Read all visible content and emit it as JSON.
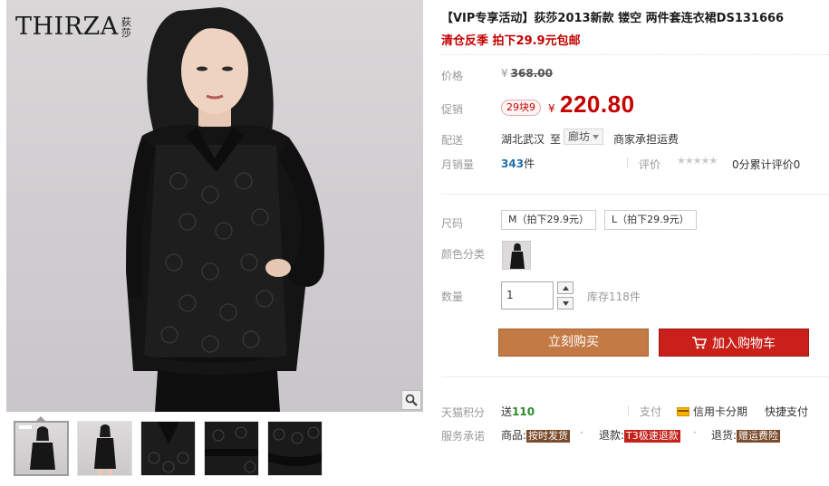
{
  "gallery": {
    "brand_name": "THIRZA",
    "brand_cn": "荻莎",
    "zoom_icon": "magnifier-icon",
    "thumbnail_count": 5
  },
  "product": {
    "title": "【VIP专享活动】荻莎2013新款 镂空 两件套连衣裙DS131666",
    "subtitle": "清仓反季 拍下29.9元包邮"
  },
  "price": {
    "label": "价格",
    "currency": "¥",
    "original": "368.00"
  },
  "promo": {
    "label": "促销",
    "badge": "29块9",
    "currency": "¥",
    "price": "220.80"
  },
  "shipping": {
    "label": "配送",
    "from": "湖北武汉",
    "to_word": "至",
    "destination": "廊坊",
    "cost": "商家承担运费"
  },
  "sales": {
    "label": "月销量",
    "count": "343",
    "unit": "件",
    "review_label": "评价",
    "stars": "★★★★★",
    "review_text": "0分累计评价0"
  },
  "sku": {
    "size_label": "尺码",
    "sizes": [
      "M（拍下29.9元）",
      "L（拍下29.9元）"
    ],
    "color_label": "颜色分类",
    "qty_label": "数量",
    "qty_value": "1",
    "stock": "库存118件"
  },
  "actions": {
    "buy_now": "立刻购买",
    "add_cart": "加入购物车"
  },
  "extras": {
    "points_label": "天猫积分",
    "points_prefix": "送",
    "points_value": "110",
    "pay_label": "支付",
    "card_pay": "信用卡分期",
    "quick_pay": "快捷支付",
    "service_label": "服务承诺",
    "svc1_prefix": "商品:",
    "svc1_tag": "按时发货",
    "svc2_prefix": "退款:",
    "svc2_tag": "T3极速退款",
    "svc3_prefix": "退货:",
    "svc3_tag": "赠运费险"
  },
  "colors": {
    "price_red": "#c40000",
    "buy_button": "#c47a45",
    "cart_button": "#c9201a"
  }
}
